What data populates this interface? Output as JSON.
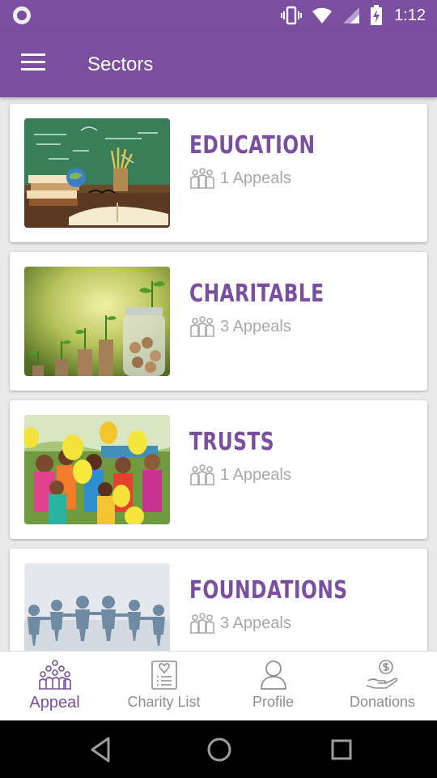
{
  "status_bar": {
    "time": "1:12"
  },
  "app_bar": {
    "title": "Sectors"
  },
  "sectors": [
    {
      "name": "EDUCATION",
      "count": "1 Appeals"
    },
    {
      "name": "CHARITABLE",
      "count": "3 Appeals"
    },
    {
      "name": "TRUSTS",
      "count": "1 Appeals"
    },
    {
      "name": "FOUNDATIONS",
      "count": "3 Appeals"
    }
  ],
  "bottom_nav": [
    {
      "label": "Appeal",
      "active": true
    },
    {
      "label": "Charity List"
    },
    {
      "label": "Profile"
    },
    {
      "label": "Donations"
    }
  ],
  "colors": {
    "primary": "#7b4ea0",
    "muted": "#a8a8a8"
  }
}
